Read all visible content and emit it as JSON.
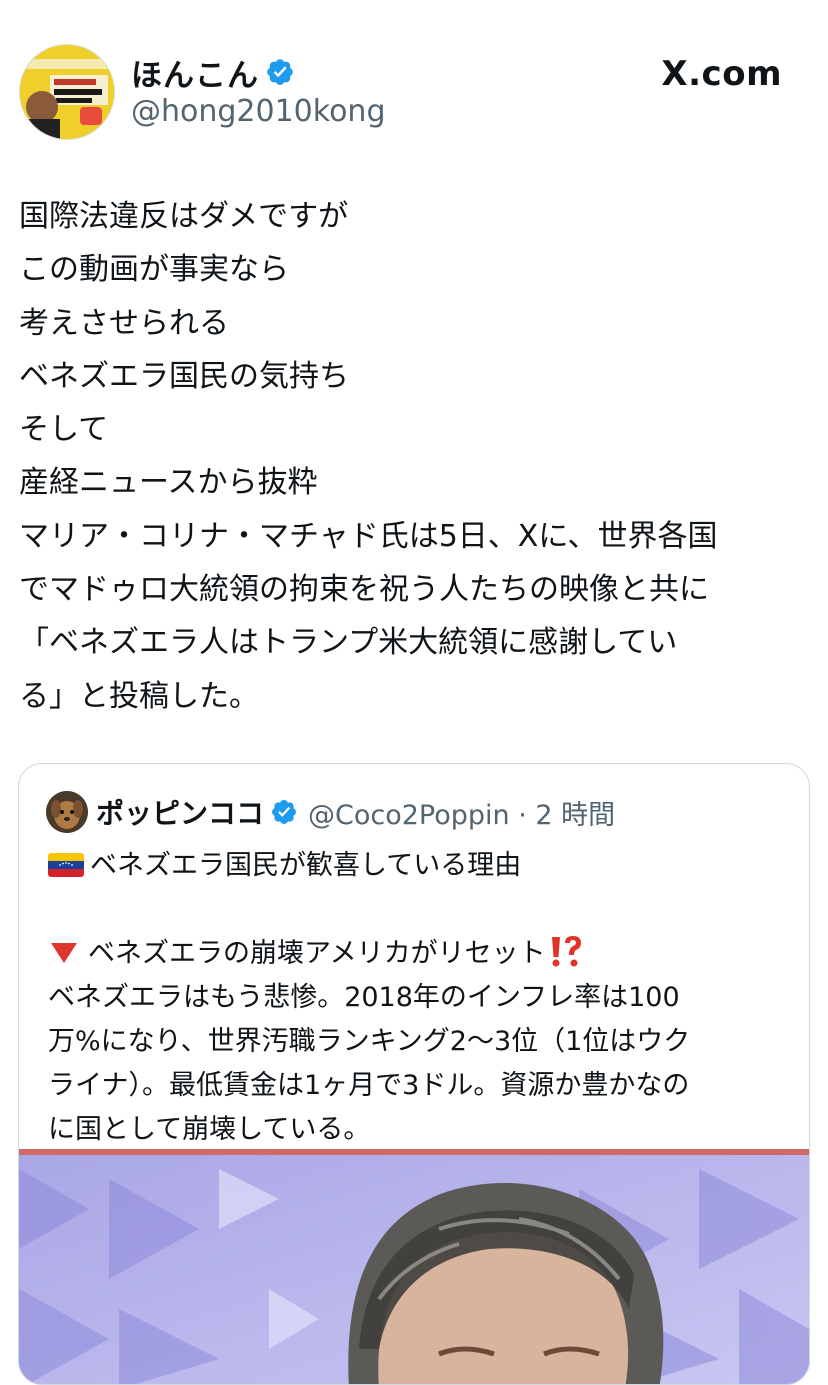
{
  "author": {
    "display_name": "ほんこん",
    "handle": "@hong2010kong",
    "avatar_icon": "book-cover-avatar"
  },
  "site_label": "X.com",
  "tweet": {
    "text": "国際法違反はダメですが\nこの動画が事実なら\n考えさせられる\nベネズエラ国民の気持ち\nそして\n産経ニュースから抜粋\nマリア・コリナ・マチャド氏は5日、Xに、世界各国\nでマドゥロ大統領の拘束を祝う人たちの映像と共に\n「ベネズエラ人はトランプ米大統領に感謝してい\nる」と投稿した。"
  },
  "quoted": {
    "display_name": "ポッピンココ",
    "handle_time": "@Coco2Poppin · 2 時間",
    "line1": "ベネズエラ国民が歓喜している理由",
    "line2": "ベネズエラの崩壊アメリカがリセット",
    "body": "ベネズエラはもう悲惨。2018年のインフレ率は100\n万%になり、世界汚職ランキング2〜3位（1位はウク\nライナ）。最低賃金は1ヶ月で3ドル。資源か豊かなの\nに国として崩壊している。"
  },
  "colors": {
    "verified_blue": "#1d9bf0",
    "text_primary": "#0f1419",
    "text_secondary": "#536471",
    "border": "#cfd9de"
  }
}
